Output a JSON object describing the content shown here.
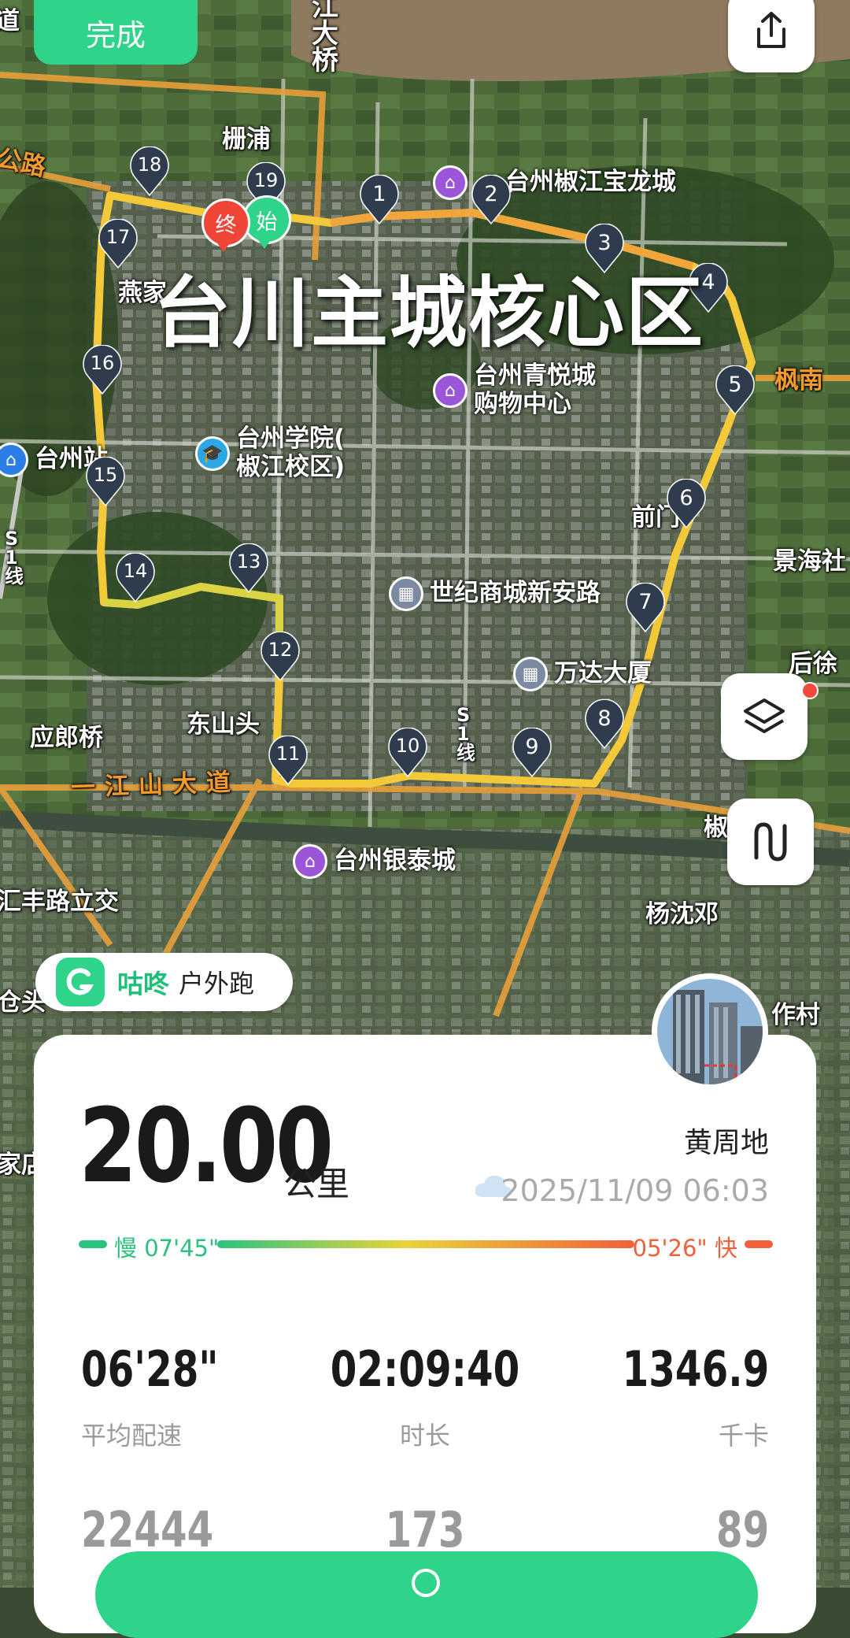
{
  "toolbar": {
    "done_label": "完成"
  },
  "map": {
    "area_title": "台川主城核心区",
    "labels": {
      "river_bridge": "江\n大\n桥",
      "shanpu": "栅浦",
      "gonglu": "公路",
      "yanjia": "燕家",
      "taizhou_station": "台州站",
      "fengnan": "枫南",
      "qianmen": "前门",
      "jinghai": "景海社",
      "houxu": "后徐",
      "donshantou": "东山头",
      "yinglangqiao": "应郎桥",
      "yijiang_road": "一江山大道",
      "huifeng": "汇丰路立交",
      "yangshendeng": "杨沈邓",
      "zuocun": "作村",
      "cangtou": "仓头",
      "jiadian": "家店",
      "jiao_lijiao": "椒江立交",
      "s1_line": "S\n1\n线",
      "s1_line_b": "S\n1\n线",
      "daoroad": "道"
    },
    "pois": {
      "baolong": "台州椒江宝龙城",
      "qingyue": "台州青悦城\n购物中心",
      "xueyuan": "台州学院(\n椒江校区)",
      "shiji": "世纪商城新安路",
      "wanda": "万达大厦",
      "yintai": "台州银泰城"
    },
    "km_markers": [
      "1",
      "2",
      "3",
      "4",
      "5",
      "6",
      "7",
      "8",
      "9",
      "10",
      "11",
      "12",
      "13",
      "14",
      "15",
      "16",
      "17",
      "18",
      "19"
    ],
    "start_label": "始",
    "end_label": "终",
    "route_color": "#f3c93a",
    "ring_road_color": "#e8a03a"
  },
  "brand": {
    "name": "咕咚",
    "activity": "户外跑"
  },
  "summary": {
    "distance": "20.00",
    "distance_unit": "公里",
    "location": "黄周地",
    "datetime": "2025/11/09 06:03",
    "pace_slow": "慢 07'45\"",
    "pace_fast": "05'26\" 快"
  },
  "stats": [
    {
      "value": "06'28\"",
      "label": "平均配速"
    },
    {
      "value": "02:09:40",
      "label": "时长"
    },
    {
      "value": "1346.9",
      "label": "千卡"
    }
  ],
  "stats_row2": [
    "22444",
    "173",
    "89"
  ],
  "colors": {
    "accent": "#2ed489",
    "pace_fast": "#f0603a",
    "pace_slow": "#2bc27e"
  }
}
